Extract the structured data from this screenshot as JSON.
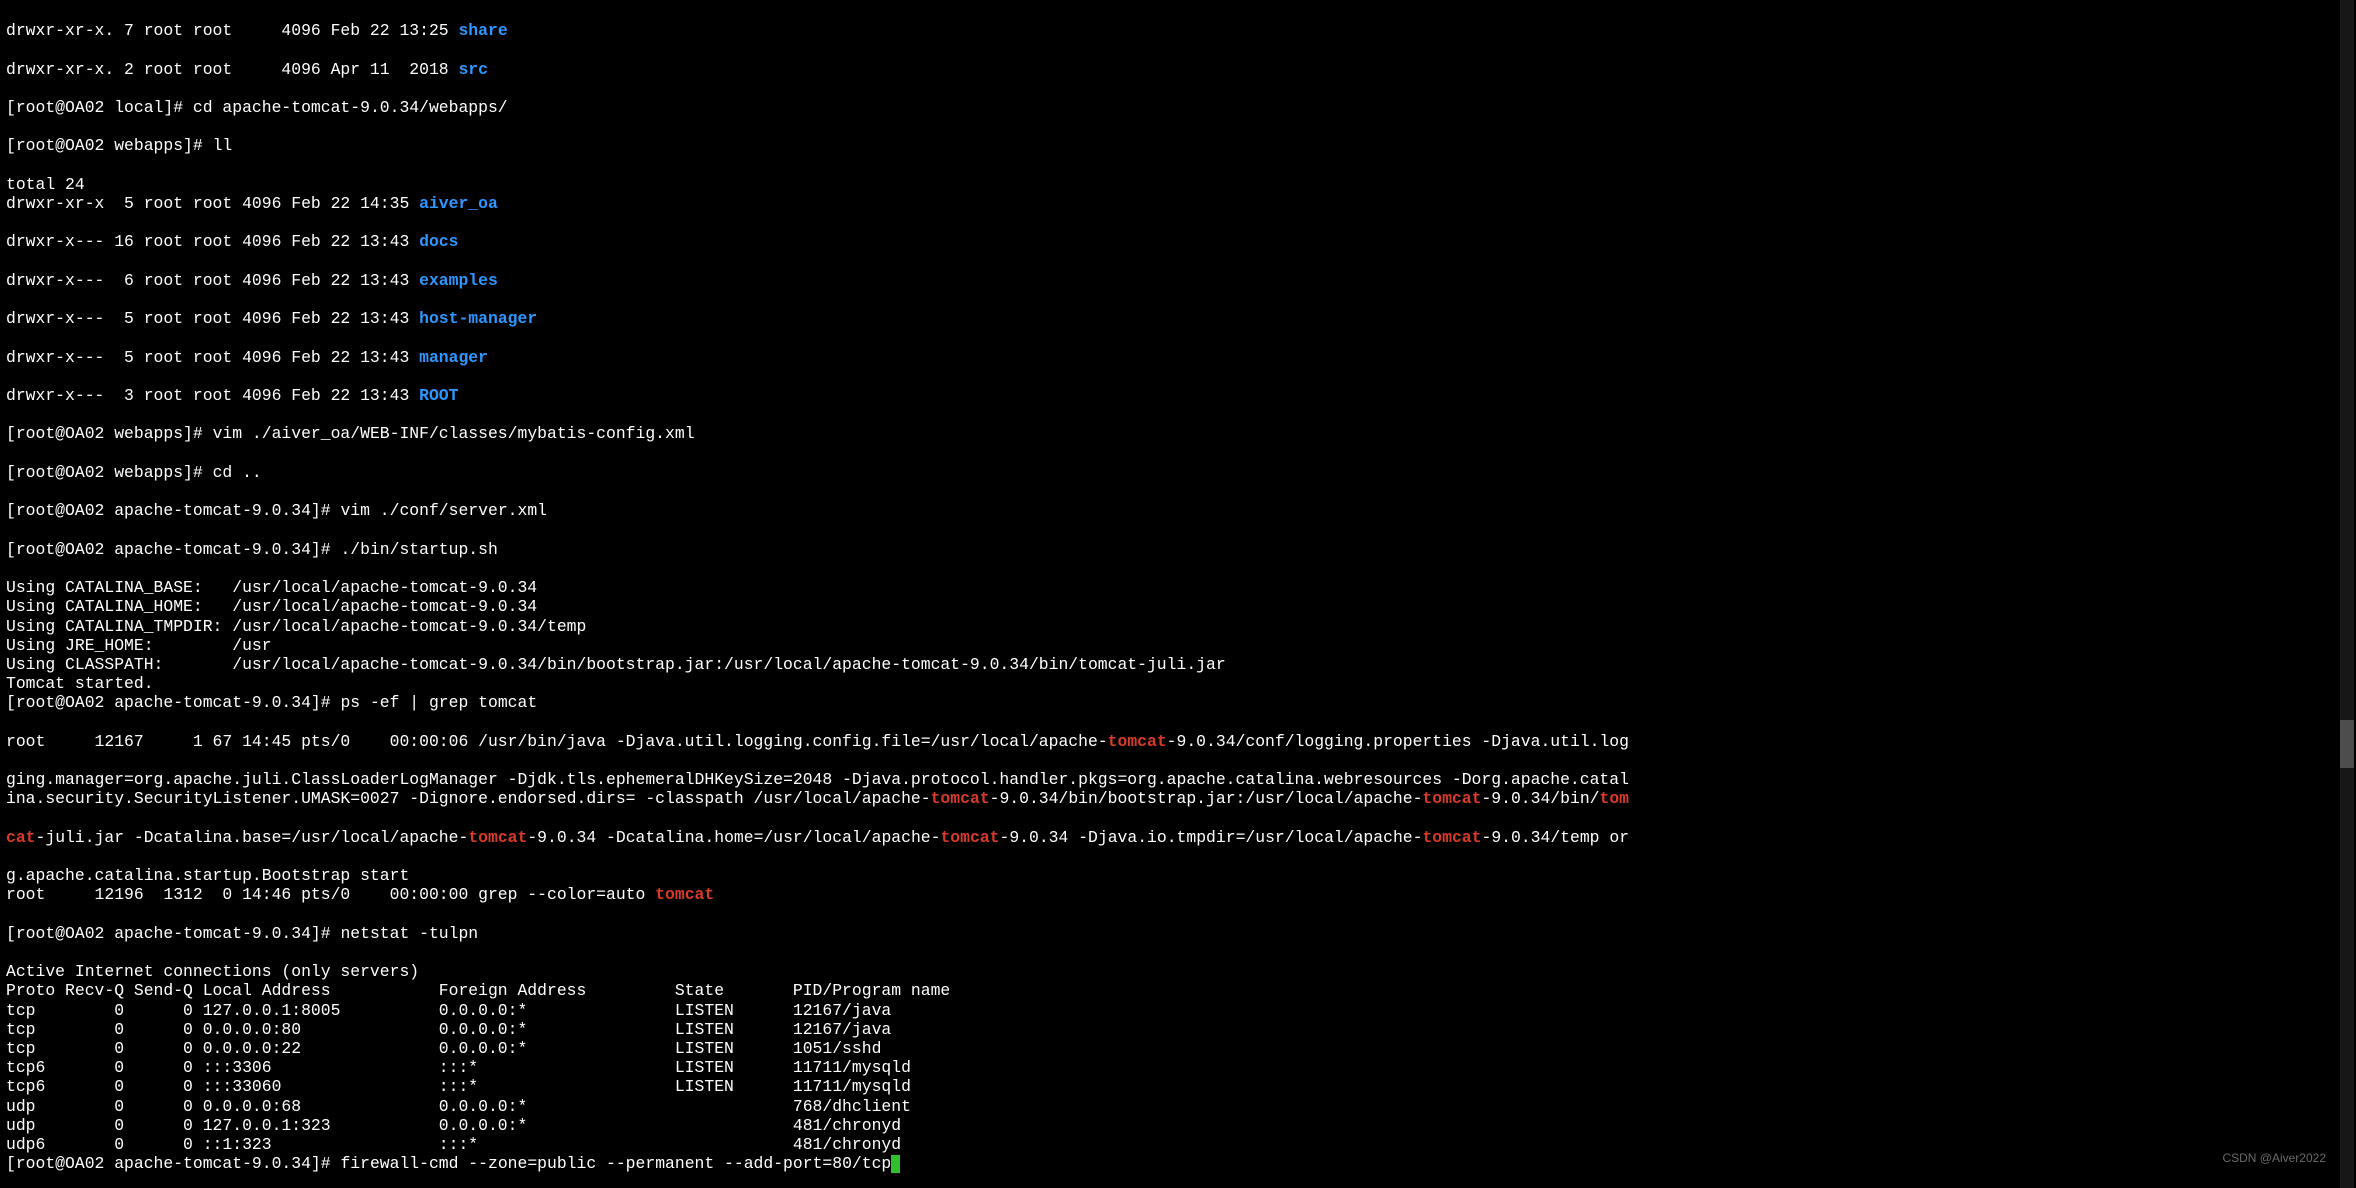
{
  "ls_local": {
    "rows": [
      {
        "perm": "drwxr-xr-x.",
        "links": "7",
        "user": "root",
        "group": "root",
        "size": "4096",
        "date": "Feb 22 13:25",
        "name": "share"
      },
      {
        "perm": "drwxr-xr-x.",
        "links": "2",
        "user": "root",
        "group": "root",
        "size": "4096",
        "date": "Apr 11  2018",
        "name": "src"
      }
    ]
  },
  "prompt1": "[root@OA02 local]# ",
  "cmd1": "cd apache-tomcat-9.0.34/webapps/",
  "prompt2": "[root@OA02 webapps]# ",
  "cmd2": "ll",
  "total": "total 24",
  "ls_webapps": {
    "rows": [
      {
        "perm": "drwxr-xr-x",
        "links": " 5",
        "user": "root",
        "group": "root",
        "size": "4096",
        "date": "Feb 22 14:35",
        "name": "aiver_oa"
      },
      {
        "perm": "drwxr-x---",
        "links": "16",
        "user": "root",
        "group": "root",
        "size": "4096",
        "date": "Feb 22 13:43",
        "name": "docs"
      },
      {
        "perm": "drwxr-x---",
        "links": " 6",
        "user": "root",
        "group": "root",
        "size": "4096",
        "date": "Feb 22 13:43",
        "name": "examples"
      },
      {
        "perm": "drwxr-x---",
        "links": " 5",
        "user": "root",
        "group": "root",
        "size": "4096",
        "date": "Feb 22 13:43",
        "name": "host-manager"
      },
      {
        "perm": "drwxr-x---",
        "links": " 5",
        "user": "root",
        "group": "root",
        "size": "4096",
        "date": "Feb 22 13:43",
        "name": "manager"
      },
      {
        "perm": "drwxr-x---",
        "links": " 3",
        "user": "root",
        "group": "root",
        "size": "4096",
        "date": "Feb 22 13:43",
        "name": "ROOT"
      }
    ]
  },
  "prompt3": "[root@OA02 webapps]# ",
  "cmd3": "vim ./aiver_oa/WEB-INF/classes/mybatis-config.xml",
  "prompt4": "[root@OA02 webapps]# ",
  "cmd4": "cd ..",
  "prompt5": "[root@OA02 apache-tomcat-9.0.34]# ",
  "cmd5": "vim ./conf/server.xml",
  "prompt6": "[root@OA02 apache-tomcat-9.0.34]# ",
  "cmd6": "./bin/startup.sh",
  "startup": {
    "l1": "Using CATALINA_BASE:   /usr/local/apache-tomcat-9.0.34",
    "l2": "Using CATALINA_HOME:   /usr/local/apache-tomcat-9.0.34",
    "l3": "Using CATALINA_TMPDIR: /usr/local/apache-tomcat-9.0.34/temp",
    "l4": "Using JRE_HOME:        /usr",
    "l5": "Using CLASSPATH:       /usr/local/apache-tomcat-9.0.34/bin/bootstrap.jar:/usr/local/apache-tomcat-9.0.34/bin/tomcat-juli.jar",
    "l6": "Tomcat started."
  },
  "prompt7": "[root@OA02 apache-tomcat-9.0.34]# ",
  "cmd7": "ps -ef | grep tomcat",
  "ps": {
    "p1a": "root     12167     1 67 14:45 pts/0    00:00:06 /usr/bin/java -Djava.util.logging.config.file=/usr/local/apache-",
    "p1b": "-9.0.34/conf/logging.properties -Djava.util.log",
    "p2a": "ging.manager=org.apache.juli.ClassLoaderLogManager -Djdk.tls.ephemeralDHKeySize=2048 -Djava.protocol.handler.pkgs=org.apache.catalina.webresources -Dorg.apache.catal",
    "p3a": "ina.security.SecurityListener.UMASK=0027 -Dignore.endorsed.dirs= -classpath /usr/local/apache-",
    "p3b": "-9.0.34/bin/bootstrap.jar:/usr/local/apache-",
    "p3c": "-9.0.34/bin/",
    "p4a": "-juli.jar -Dcatalina.base=/usr/local/apache-",
    "p4b": "-9.0.34 -Dcatalina.home=/usr/local/apache-",
    "p4c": "-9.0.34 -Djava.io.tmpdir=/usr/local/apache-",
    "p4d": "-9.0.34/temp or",
    "p5": "g.apache.catalina.startup.Bootstrap start",
    "p6a": "root     12196  1312  0 14:46 pts/0    00:00:00 grep --color=auto ",
    "tom": "tom",
    "cat": "cat",
    "tomcat": "tomcat"
  },
  "prompt8": "[root@OA02 apache-tomcat-9.0.34]# ",
  "cmd8": "netstat -tulpn",
  "net": {
    "head": "Active Internet connections (only servers)",
    "cols": "Proto Recv-Q Send-Q Local Address           Foreign Address         State       PID/Program name    ",
    "rows": [
      "tcp        0      0 127.0.0.1:8005          0.0.0.0:*               LISTEN      12167/java          ",
      "tcp        0      0 0.0.0.0:80              0.0.0.0:*               LISTEN      12167/java          ",
      "tcp        0      0 0.0.0.0:22              0.0.0.0:*               LISTEN      1051/sshd           ",
      "tcp6       0      0 :::3306                 :::*                    LISTEN      11711/mysqld        ",
      "tcp6       0      0 :::33060                :::*                    LISTEN      11711/mysqld        ",
      "udp        0      0 0.0.0.0:68              0.0.0.0:*                           768/dhclient        ",
      "udp        0      0 127.0.0.1:323           0.0.0.0:*                           481/chronyd         ",
      "udp6       0      0 ::1:323                 :::*                                481/chronyd         "
    ]
  },
  "prompt9": "[root@OA02 apache-tomcat-9.0.34]# ",
  "cmd9": "firewall-cmd --zone=public --permanent --add-port=80/tcp",
  "watermark": "CSDN @Aiver2022"
}
